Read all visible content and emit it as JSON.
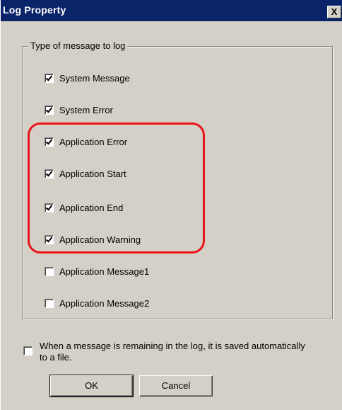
{
  "window": {
    "title": "Log Property",
    "close_glyph": "X"
  },
  "group": {
    "legend": "Type of message to log",
    "items": [
      {
        "label": "System Message",
        "checked": true
      },
      {
        "label": "System Error",
        "checked": true
      },
      {
        "label": "Application Error",
        "checked": true
      },
      {
        "label": "Application Start",
        "checked": true
      },
      {
        "label": "Application End",
        "checked": true
      },
      {
        "label": "Application Warning",
        "checked": true
      },
      {
        "label": "Application Message1",
        "checked": false
      },
      {
        "label": "Application Message2",
        "checked": false
      }
    ]
  },
  "autosave": {
    "label": "When a message is remaining in the log, it is saved automatically to a file.",
    "checked": false
  },
  "buttons": {
    "ok": "OK",
    "cancel": "Cancel"
  },
  "colors": {
    "title_bar": "#0a246a",
    "dialog_face": "#d4d0c8",
    "highlight_outline": "#e8141b"
  }
}
